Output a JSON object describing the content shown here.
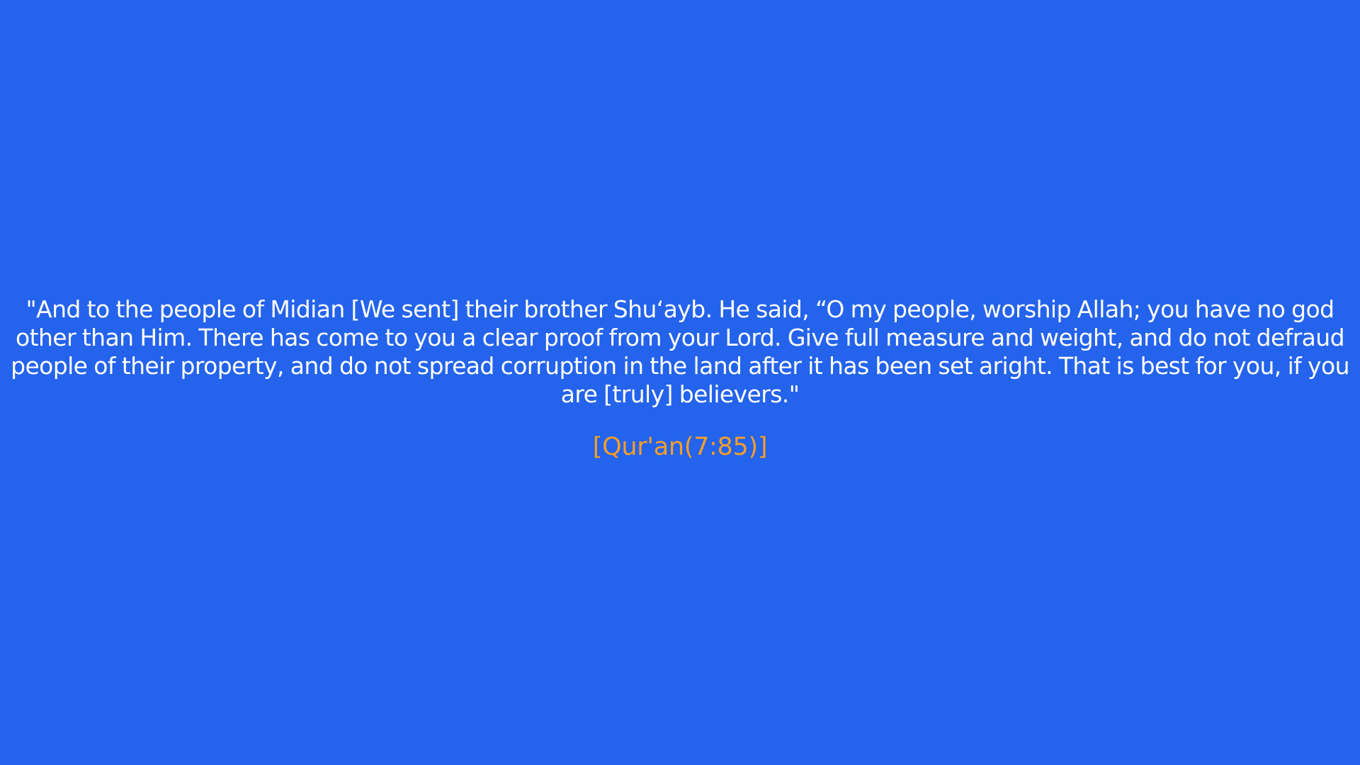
{
  "quote": {
    "text": "\"And to the people of Midian [We sent] their brother Shu‘ayb. He said, “O my people, worship Allah; you have no god other than Him. There has come to you a clear proof from your Lord. Give full measure and weight, and do not defraud people of their property, and do not spread corruption in the land after it has been set aright. That is best for you, if you are [truly] believers.\"",
    "citation": "[Qur'an(7:85)]"
  },
  "colors": {
    "background": "#2463EB",
    "text": "#FFFFFF",
    "citation": "#F59E2A"
  }
}
